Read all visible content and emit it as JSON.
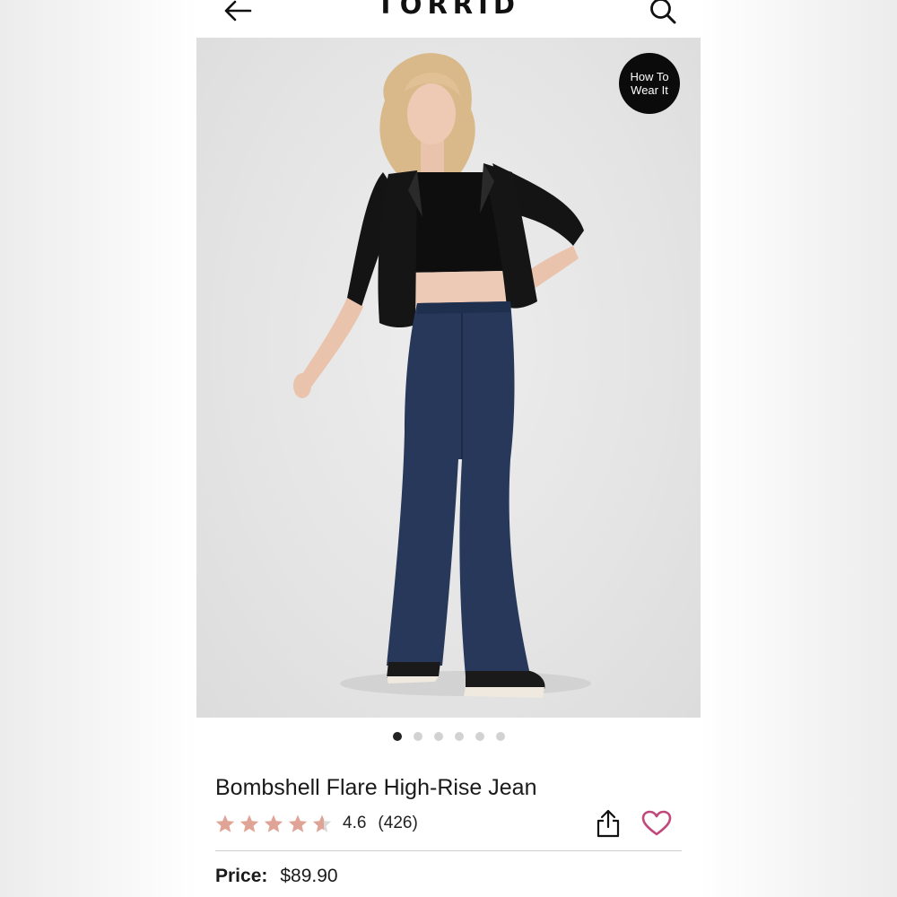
{
  "header": {
    "brand": "TORRID",
    "back_icon": "arrow-left-icon",
    "search_icon": "search-icon"
  },
  "hero": {
    "badge_line1": "How To",
    "badge_line2": "Wear It",
    "image_alt": "product-photo"
  },
  "carousel": {
    "total": 6,
    "active_index": 0
  },
  "product": {
    "title": "Bombshell Flare High-Rise Jean",
    "rating": "4.6",
    "review_count": "(426)",
    "rating_value": 4.6,
    "rating_max": 5,
    "star_color": "#e0a496",
    "star_empty_color": "#d9d9d9",
    "share_icon": "share-icon",
    "favorite_icon": "heart-icon",
    "favorite_color": "#c2477a",
    "price_label": "Price:",
    "price": "$89.90"
  }
}
